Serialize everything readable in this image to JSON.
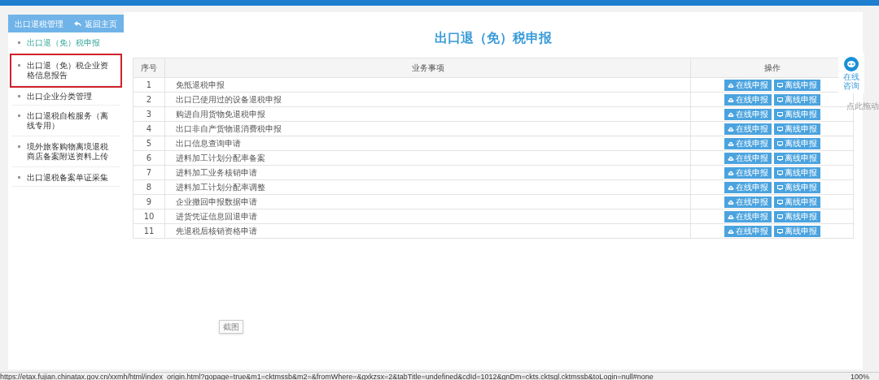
{
  "sidebar": {
    "title": "出口退税管理",
    "back_link": "返回主页",
    "items": [
      {
        "label": "出口退（免）税申报",
        "selected": true,
        "highlighted": false
      },
      {
        "label": "出口退（免）税企业资格信息报告",
        "selected": false,
        "highlighted": true
      },
      {
        "label": "出口企业分类管理",
        "selected": false,
        "highlighted": false
      },
      {
        "label": "出口退税自检服务（离线专用）",
        "selected": false,
        "highlighted": false
      },
      {
        "label": "境外旅客购物离境退税商店备案附送资料上传",
        "selected": false,
        "highlighted": false
      },
      {
        "label": "出口退税备案单证采集",
        "selected": false,
        "highlighted": false
      }
    ]
  },
  "main": {
    "title": "出口退（免）税申报",
    "table": {
      "columns": [
        "序号",
        "业务事项",
        "操作"
      ],
      "rows": [
        {
          "no": "1",
          "item": "免抵退税申报",
          "actions": [
            "在线申报",
            "离线申报"
          ]
        },
        {
          "no": "2",
          "item": "出口已使用过的设备退税申报",
          "actions": [
            "在线申报",
            "离线申报"
          ]
        },
        {
          "no": "3",
          "item": "购进自用货物免退税申报",
          "actions": [
            "在线申报",
            "离线申报"
          ]
        },
        {
          "no": "4",
          "item": "出口非自产货物退消费税申报",
          "actions": [
            "在线申报",
            "离线申报"
          ]
        },
        {
          "no": "5",
          "item": "出口信息查询申请",
          "actions": [
            "在线申报",
            "离线申报"
          ]
        },
        {
          "no": "6",
          "item": "进料加工计划分配率备案",
          "actions": [
            "在线申报",
            "离线申报"
          ]
        },
        {
          "no": "7",
          "item": "进料加工业务核销申请",
          "actions": [
            "在线申报",
            "离线申报"
          ]
        },
        {
          "no": "8",
          "item": "进料加工计划分配率调整",
          "actions": [
            "在线申报",
            "离线申报"
          ]
        },
        {
          "no": "9",
          "item": "企业撤回申报数据申请",
          "actions": [
            "在线申报",
            "离线申报"
          ]
        },
        {
          "no": "10",
          "item": "进货凭证信息回退申请",
          "actions": [
            "在线申报",
            "离线申报"
          ]
        },
        {
          "no": "11",
          "item": "先退税后核销资格申请",
          "actions": [
            "在线申报",
            "离线申报"
          ]
        }
      ]
    },
    "tooltip": "截图"
  },
  "consult_widget": {
    "label": "在线咨询",
    "hint": "点此拖动"
  },
  "status_bar": {
    "url": "https://etax.fujian.chinatax.gov.cn/xxmh/html/index_origin.html?gopage=true&m1=cktmssb&m2=&fromWhere=&gxkzsx=2&tabTitle=undefined&cdId=1012&gnDm=ckts.cktsgl.cktmssb&toLogin=null#none",
    "zoom": "100%"
  }
}
